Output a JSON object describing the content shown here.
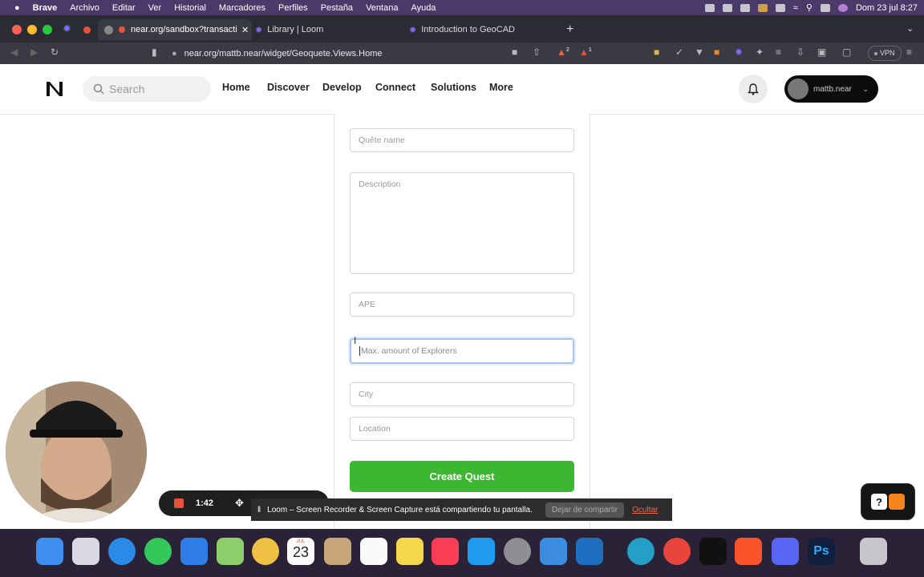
{
  "menubar": {
    "apple": "",
    "items": [
      "Brave",
      "Archivo",
      "Editar",
      "Ver",
      "Historial",
      "Marcadores",
      "Perfiles",
      "Pestaña",
      "Ventana",
      "Ayuda"
    ],
    "clock": "Dom 23 jul  8:27"
  },
  "tabs": [
    {
      "label": "near.org/sandbox?transactio",
      "active": true
    },
    {
      "label": "Library | Loom",
      "active": false
    },
    {
      "label": "Introduction to GeoCAD",
      "active": false
    }
  ],
  "toolbar": {
    "url": "near.org/mattb.near/widget/Geoquete.Views.Home",
    "brave_badge": "2",
    "rewards_badge": "1",
    "vpn": "VPN"
  },
  "nav": {
    "search_placeholder": "Search",
    "links": [
      "Home",
      "Discover",
      "Develop",
      "Connect",
      "Solutions",
      "More"
    ],
    "profile_name": "mattb.near"
  },
  "form": {
    "name_placeholder": "Quête name",
    "description_placeholder": "Description",
    "ape_placeholder": "APE",
    "explorers_placeholder": "Max. amount of Explorers",
    "city_placeholder": "City",
    "location_placeholder": "Location",
    "submit_label": "Create Quest"
  },
  "recorder": {
    "time": "1:42"
  },
  "share_banner": {
    "message": "Loom – Screen Recorder & Screen Capture está compartiendo tu pantalla.",
    "stop_label": "Dejar de compartir",
    "hide_label": "Ocultar"
  },
  "dock": {
    "calendar_month": "JUL",
    "calendar_day": "23",
    "photoshop": "Ps"
  },
  "colors": {
    "primary_button": "#3cb731",
    "focus_ring": "#a6c4ee",
    "menubar": "#4a3a6a"
  }
}
